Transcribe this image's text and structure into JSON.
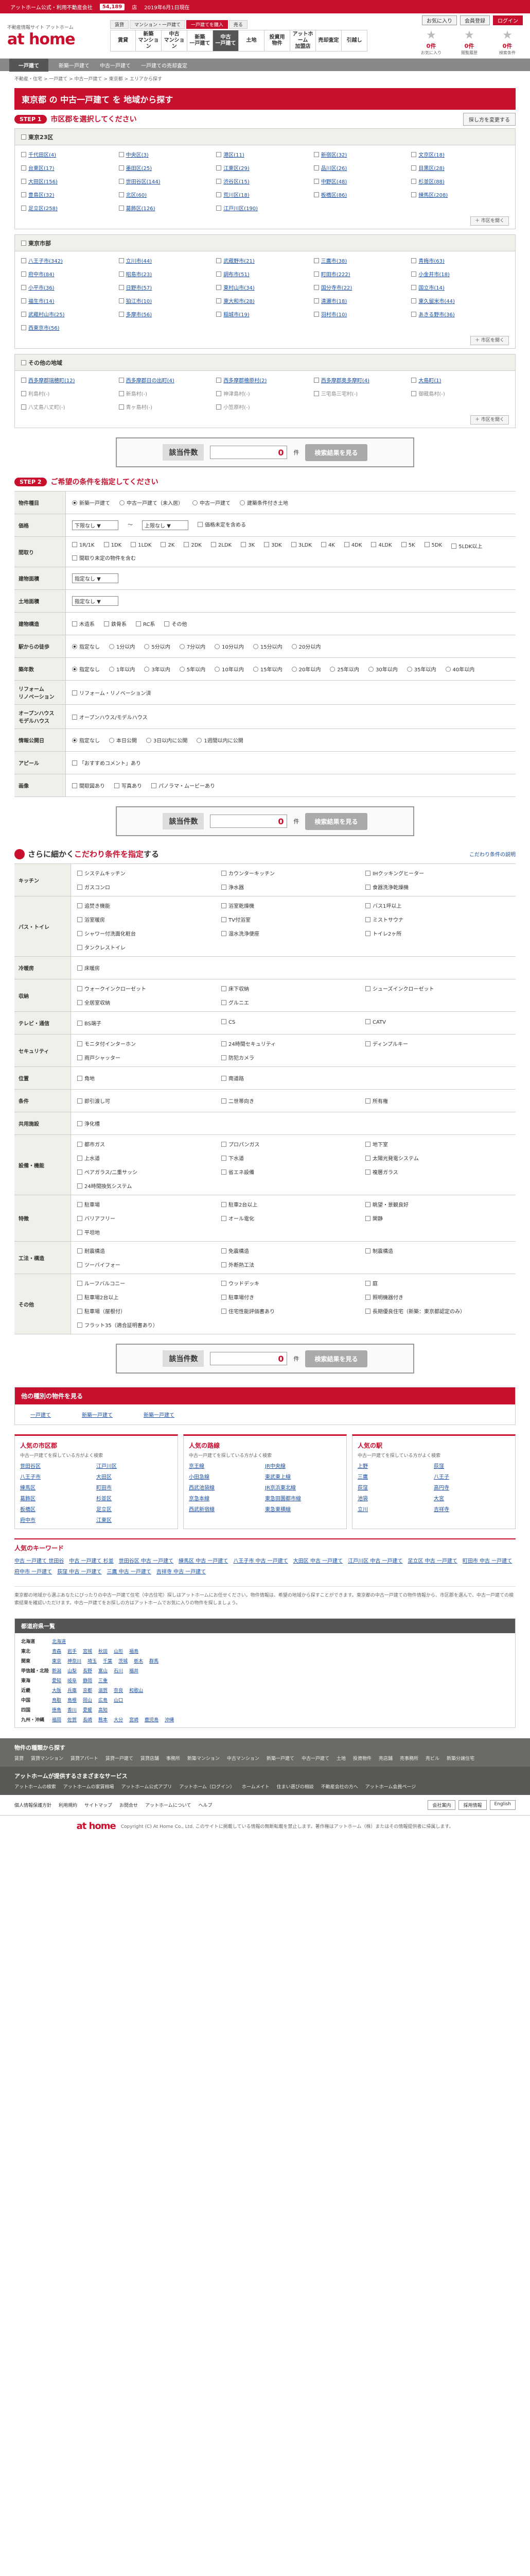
{
  "topbar": {
    "site": "アットホーム公式・利用不動産会社",
    "tel": "54,189",
    "tel_suffix": "店",
    "text2": "2019年6月1日現在"
  },
  "header": {
    "site_desc": "不動産情報サイト アットホーム",
    "logo": "at home",
    "categories": [
      "賃貸",
      "マンション・一戸建て",
      "一戸建てを購入",
      "売る"
    ],
    "nav": [
      "賃貸",
      "新築\nマンション",
      "中古\nマンション",
      "新築\n一戸建て",
      "中古\n一戸建て",
      "土地",
      "投資用\n物件",
      "アットホーム\n加盟店",
      "売却査定",
      "引越し"
    ],
    "active_nav_index": 4,
    "btns": [
      "お気に入り",
      "会員登録",
      "ログイン"
    ],
    "icons": [
      {
        "label": "お気に入り",
        "count": "0件"
      },
      {
        "label": "閲覧履歴",
        "count": "0件"
      },
      {
        "label": "検索条件",
        "count": "0件"
      }
    ]
  },
  "subnav": [
    "一戸建て",
    "新築一戸建て",
    "中古一戸建て",
    "一戸建ての売却査定"
  ],
  "breadcrumbs": "不動産・住宅 > 一戸建て > 中古一戸建て > 東京都 > エリアから探す",
  "page_title": "東京都 の 中古一戸建て を 地域から探す",
  "step1": {
    "badge": "STEP 1",
    "title": "市区郡を選択してください",
    "sort": "探し方を変更する"
  },
  "regions": [
    {
      "name": "東京23区",
      "items": [
        "千代田区(4)",
        "中央区(3)",
        "港区(11)",
        "新宿区(32)",
        "文京区(18)",
        "台東区(17)",
        "墨田区(25)",
        "江東区(29)",
        "品川区(26)",
        "目黒区(28)",
        "大田区(156)",
        "世田谷区(144)",
        "渋谷区(15)",
        "中野区(48)",
        "杉並区(88)",
        "豊島区(32)",
        "北区(60)",
        "荒川区(18)",
        "板橋区(86)",
        "練馬区(208)",
        "足立区(258)",
        "葛飾区(126)",
        "江戸川区(190)"
      ],
      "more": "＋ 市区を開く"
    },
    {
      "name": "東京市部",
      "items": [
        "八王子市(342)",
        "立川市(44)",
        "武蔵野市(21)",
        "三鷹市(38)",
        "青梅市(63)",
        "府中市(84)",
        "昭島市(23)",
        "調布市(51)",
        "町田市(222)",
        "小金井市(18)",
        "小平市(36)",
        "日野市(57)",
        "東村山市(34)",
        "国分寺市(22)",
        "国立市(14)",
        "福生市(14)",
        "狛江市(10)",
        "東大和市(28)",
        "清瀬市(18)",
        "東久留米市(44)",
        "武蔵村山市(25)",
        "多摩市(56)",
        "稲城市(19)",
        "羽村市(10)",
        "あきる野市(36)",
        "西東京市(56)"
      ],
      "more": "＋ 市区を開く"
    },
    {
      "name": "その他の地域",
      "items": [
        "西多摩郡瑞穂町(12)",
        "西多摩郡日の出町(4)",
        "西多摩郡檜原村(2)",
        "西多摩郡奥多摩町(4)",
        "大島町(1)",
        "利島村(-)",
        "新島村(-)",
        "神津島村(-)",
        "三宅島三宅村(-)",
        "御蔵島村(-)",
        "八丈島八丈町(-)",
        "青ヶ島村(-)",
        "小笠原村(-)"
      ],
      "more": "＋ 市区を開く"
    }
  ],
  "count": {
    "label": "該当件数",
    "value": "0",
    "unit": "件",
    "btn": "検索結果を見る"
  },
  "step2": {
    "badge": "STEP 2",
    "title": "ご希望の条件を指定してください"
  },
  "conditions": [
    {
      "h": "物件種目",
      "opts": [
        "新築一戸建て",
        "中古一戸建て（未入居）",
        "中古一戸建て",
        "建築条件付き土地"
      ]
    },
    {
      "h": "価格",
      "opts": [
        "下限なし ▼",
        "〜",
        "上限なし ▼",
        "価格未定を含める"
      ]
    },
    {
      "h": "間取り",
      "opts": [
        "1R/1K",
        "1DK",
        "1LDK",
        "2K",
        "2DK",
        "2LDK",
        "3K",
        "3DK",
        "3LDK",
        "4K",
        "4DK",
        "4LDK",
        "5K",
        "5DK",
        "5LDK以上",
        "間取り未定の物件を含む"
      ]
    },
    {
      "h": "建物面積",
      "opts": [
        "指定なし ▼"
      ]
    },
    {
      "h": "土地面積",
      "opts": [
        "指定なし ▼"
      ]
    },
    {
      "h": "建物構造",
      "opts": [
        "木造系",
        "鉄骨系",
        "RC系",
        "その他"
      ]
    },
    {
      "h": "駅からの徒歩",
      "opts": [
        "指定なし",
        "1分以内",
        "5分以内",
        "7分以内",
        "10分以内",
        "15分以内",
        "20分以内"
      ]
    },
    {
      "h": "築年数",
      "opts": [
        "指定なし",
        "1年以内",
        "3年以内",
        "5年以内",
        "10年以内",
        "15年以内",
        "20年以内",
        "25年以内",
        "30年以内",
        "35年以内",
        "40年以内"
      ]
    },
    {
      "h": "リフォーム\nリノベーション",
      "opts": [
        "リフォーム・リノベーション済"
      ]
    },
    {
      "h": "オープンハウス\nモデルハウス",
      "opts": [
        "オープンハウス/モデルハウス"
      ]
    },
    {
      "h": "情報公開日",
      "opts": [
        "指定なし",
        "本日公開",
        "3日以内に公開",
        "1週間以内に公開"
      ]
    },
    {
      "h": "アピール",
      "opts": [
        "「おすすめコメント」あり"
      ]
    },
    {
      "h": "画像",
      "opts": [
        "間取図あり",
        "写真あり",
        "パノラマ・ムービーあり"
      ]
    }
  ],
  "kodawari": {
    "title_pre": "さらに細かく",
    "title_hl": "こだわり条件を指定",
    "title_post": "する",
    "note": "こだわり条件の説明",
    "rows": [
      {
        "h": "キッチン",
        "opts": [
          "システムキッチン",
          "カウンターキッチン",
          "IHクッキングヒーター",
          "ガスコンロ",
          "浄水器",
          "食器洗浄乾燥機"
        ]
      },
      {
        "h": "バス・トイレ",
        "opts": [
          "追焚き機能",
          "浴室乾燥機",
          "バス1坪以上",
          "浴室暖房",
          "TV付浴室",
          "ミストサウナ",
          "シャワー付洗面化粧台",
          "温水洗浄便座",
          "トイレ2ヶ所",
          "タンクレストイレ"
        ]
      },
      {
        "h": "冷暖房",
        "opts": [
          "床暖房"
        ]
      },
      {
        "h": "収納",
        "opts": [
          "ウォークインクローゼット",
          "床下収納",
          "シューズインクローゼット",
          "全居室収納",
          "グルニエ"
        ]
      },
      {
        "h": "テレビ・通信",
        "opts": [
          "BS端子",
          "CS",
          "CATV"
        ]
      },
      {
        "h": "セキュリティ",
        "opts": [
          "モニタ付インターホン",
          "24時間セキュリティ",
          "ディンプルキー",
          "雨戸シャッター",
          "防犯カメラ"
        ]
      },
      {
        "h": "位置",
        "opts": [
          "角地",
          "南道路"
        ]
      },
      {
        "h": "条件",
        "opts": [
          "即引渡し可",
          "二世帯向き",
          "所有権"
        ]
      },
      {
        "h": "共用施設",
        "opts": [
          "浄化槽"
        ]
      },
      {
        "h": "設備・機能",
        "opts": [
          "都市ガス",
          "プロパンガス",
          "地下室",
          "上水道",
          "下水道",
          "太陽光発電システム",
          "ペアガラス/二重サッシ",
          "省エネ設備",
          "複層ガラス",
          "24時間換気システム"
        ]
      },
      {
        "h": "特徴",
        "opts": [
          "駐車場",
          "駐車2台以上",
          "眺望・景観良好",
          "バリアフリー",
          "オール電化",
          "閑静",
          "平坦地"
        ]
      },
      {
        "h": "工法・構造",
        "opts": [
          "耐震構造",
          "免震構造",
          "制震構造",
          "ツーバイフォー",
          "外断熱工法"
        ]
      },
      {
        "h": "その他",
        "opts": [
          "ルーフバルコニー",
          "ウッドデッキ",
          "庭",
          "駐車場2台以上",
          "駐車場付き",
          "照明機器付き",
          "駐車場（屋根付）",
          "住宅性能評価書あり",
          "長期優良住宅（新築：東京都認定のみ）",
          "フラット35（適合証明書あり）"
        ]
      }
    ]
  },
  "other_types": {
    "title": "他の種別の物件を見る",
    "items": [
      "一戸建て",
      "新築一戸建て",
      "新築一戸建て"
    ]
  },
  "popular": [
    {
      "title": "人気の市区郡",
      "sub": "中古一戸建てを探している方がよく検索",
      "items": [
        "世田谷区",
        "江戸川区",
        "八王子市",
        "大田区",
        "練馬区",
        "町田市",
        "葛飾区",
        "杉並区",
        "板橋区",
        "足立区",
        "府中市",
        "江東区"
      ]
    },
    {
      "title": "人気の路線",
      "sub": "中古一戸建てを探している方がよく検索",
      "items": [
        "京王線",
        "JR中央線",
        "小田急線",
        "東武東上線",
        "西武池袋線",
        "JR京浜東北線",
        "京急本線",
        "東急田園都市線",
        "西武新宿線",
        "東急東横線"
      ]
    },
    {
      "title": "人気の駅",
      "sub": "中古一戸建てを探している方がよく検索",
      "items": [
        "上野",
        "荻窪",
        "三鷹",
        "八王子",
        "荻窪",
        "高円寺",
        "池袋",
        "大宮",
        "立川",
        "吉祥寺"
      ]
    }
  ],
  "keyword": {
    "title": "人気のキーワード",
    "items": [
      "中古 一戸建て 世田谷",
      "中古 一戸建て 杉並",
      "世田谷区 中古 一戸建て",
      "練馬区 中古 一戸建て",
      "八王子市 中古 一戸建て",
      "大田区 中古 一戸建て",
      "江戸川区 中古 一戸建て",
      "足立区 中古 一戸建て",
      "町田市 中古 一戸建て",
      "府中市 一戸建て",
      "荻窪 中古 一戸建て",
      "三鷹 中古 一戸建て",
      "吉祥寺 中古 一戸建て"
    ]
  },
  "description": "東京都の地域から選ぶあなたにぴったりの中古一戸建て住宅（中古住宅）探しはアットホームにお任せください。物件情報は、希望の地域から探すことができます。東京都の中古一戸建ての物件情報から、市区郡を選んで、中古一戸建ての検索結果を確認いただけます。中古一戸建てをお探しの方はアットホームでお気に入りの物件を探しましょう。",
  "prefs": {
    "title": "都道府県一覧",
    "rows": [
      {
        "r": "北海道",
        "p": [
          "北海道"
        ]
      },
      {
        "r": "東北",
        "p": [
          "青森",
          "岩手",
          "宮城",
          "秋田",
          "山形",
          "福島"
        ]
      },
      {
        "r": "関東",
        "p": [
          "東京",
          "神奈川",
          "埼玉",
          "千葉",
          "茨城",
          "栃木",
          "群馬"
        ]
      },
      {
        "r": "甲信越・北陸",
        "p": [
          "新潟",
          "山梨",
          "長野",
          "富山",
          "石川",
          "福井"
        ]
      },
      {
        "r": "東海",
        "p": [
          "愛知",
          "岐阜",
          "静岡",
          "三重"
        ]
      },
      {
        "r": "近畿",
        "p": [
          "大阪",
          "兵庫",
          "京都",
          "滋賀",
          "奈良",
          "和歌山"
        ]
      },
      {
        "r": "中国",
        "p": [
          "鳥取",
          "島根",
          "岡山",
          "広島",
          "山口"
        ]
      },
      {
        "r": "四国",
        "p": [
          "徳島",
          "香川",
          "愛媛",
          "高知"
        ]
      },
      {
        "r": "九州・沖縄",
        "p": [
          "福岡",
          "佐賀",
          "長崎",
          "熊本",
          "大分",
          "宮崎",
          "鹿児島",
          "沖縄"
        ]
      }
    ]
  },
  "footer1": {
    "title": "物件の種類から探す",
    "items": [
      "賃貸",
      "賃貸マンション",
      "賃貸アパート",
      "賃貸一戸建て",
      "賃貸店舗",
      "事務所",
      "新築マンション",
      "中古マンション",
      "新築一戸建て",
      "中古一戸建て",
      "土地",
      "投資物件",
      "売店舗",
      "売事務所",
      "売ビル",
      "新築分譲住宅"
    ]
  },
  "footer2": {
    "title": "アットホームが提供するさまざまなサービス",
    "items": [
      "アットホームの検索",
      "アットホームの家賃相場",
      "アットホーム公式アプリ",
      "アットホーム（ログイン）",
      "ホームメイト",
      "住まい選びの相談",
      "不動産会社の方へ",
      "アットホーム会員ページ"
    ]
  },
  "footer_links": [
    "個人情報保護方針",
    "利用規約",
    "サイトマップ",
    "お問合せ",
    "アットホームについて",
    "ヘルプ"
  ],
  "footer_btns": [
    "会社案内",
    "採用情報",
    "English"
  ],
  "copyright": "Copyright (C) At Home Co., Ltd. このサイトに掲載している情報の無断転載を禁止します。著作権はアットホーム（株）またはその情報提供者に帰属します。",
  "colors": {
    "brand": "#c8102e",
    "header_gray": "#555555",
    "footer_gray": "#6b6a66"
  }
}
